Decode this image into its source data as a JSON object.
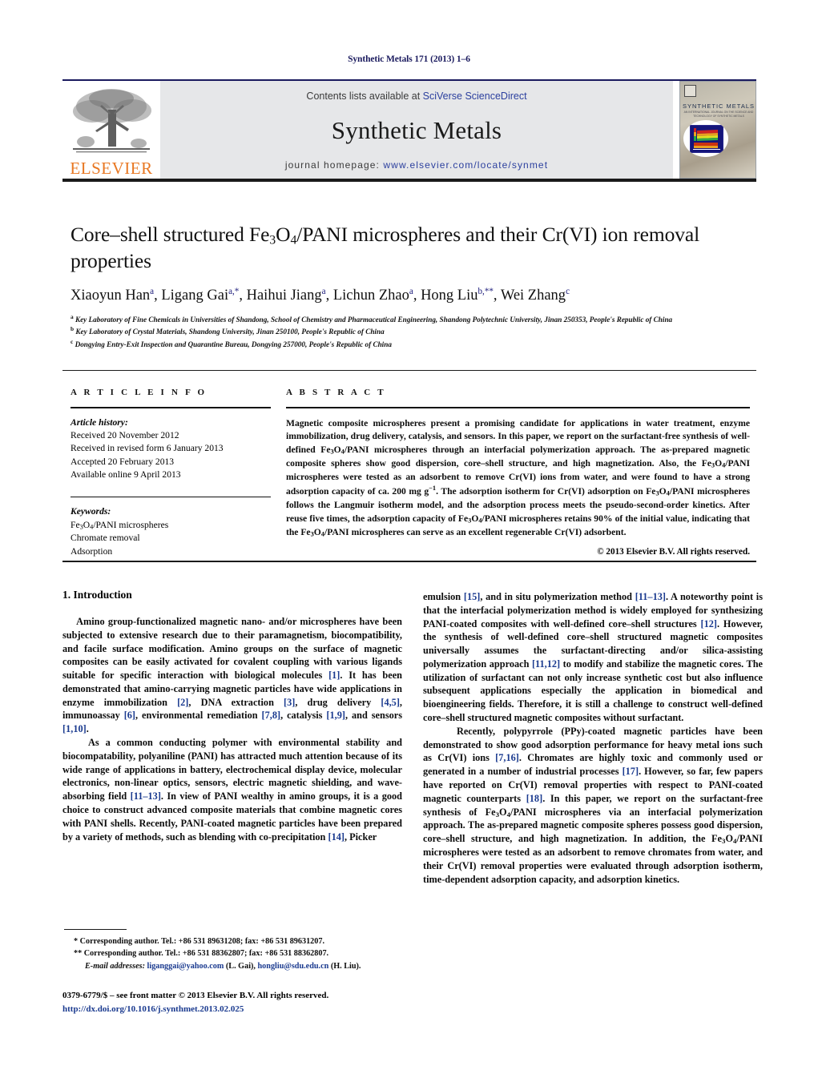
{
  "running_head": "Synthetic Metals 171 (2013) 1–6",
  "masthead": {
    "contents_prefix": "Contents lists available at ",
    "contents_brand": "SciVerse ScienceDirect",
    "journal_name": "Synthetic Metals",
    "homepage_prefix": "journal homepage: ",
    "homepage_url": "www.elsevier.com/locate/synmet",
    "publisher_wordmark": "ELSEVIER",
    "publisher_accent_color": "#E87722",
    "link_color": "#2b3f9e",
    "cover": {
      "title": "SYNTHETIC METALS",
      "subtitle": "AN INTERNATIONAL JOURNAL ON THE SCIENCE AND TECHNOLOGY OF SYNTHETIC METALS"
    }
  },
  "article": {
    "title_part1": "Core–shell structured Fe",
    "title_sub1": "3",
    "title_part2": "O",
    "title_sub2": "4",
    "title_part3": "/PANI microspheres and their Cr(VI) ion removal properties",
    "authors": "Xiaoyun Han a, Ligang Gai a,*, Haihui Jiang a, Lichun Zhao a, Hong Liu b,**, Wei Zhang c",
    "affiliations": [
      "a Key Laboratory of Fine Chemicals in Universities of Shandong, School of Chemistry and Pharmaceutical Engineering, Shandong Polytechnic University, Jinan 250353, People's Republic of China",
      "b Key Laboratory of Crystal Materials, Shandong University, Jinan 250100, People's Republic of China",
      "c Dongying Entry-Exit Inspection and Quarantine Bureau, Dongying 257000, People's Republic of China"
    ]
  },
  "article_info": {
    "heading": "A R T I C L E   I N F O",
    "history_label": "Article history:",
    "history": [
      "Received 20 November 2012",
      "Received in revised form 6 January 2013",
      "Accepted 20 February 2013",
      "Available online 9 April 2013"
    ],
    "keywords_label": "Keywords:",
    "keywords": [
      "Fe3O4/PANI microspheres",
      "Chromate removal",
      "Adsorption"
    ]
  },
  "abstract": {
    "heading": "A B S T R A C T",
    "text": "Magnetic composite microspheres present a promising candidate for applications in water treatment, enzyme immobilization, drug delivery, catalysis, and sensors. In this paper, we report on the surfactant-free synthesis of well-defined Fe3O4/PANI microspheres through an interfacial polymerization approach. The as-prepared magnetic composite spheres show good dispersion, core–shell structure, and high magnetization. Also, the Fe3O4/PANI microspheres were tested as an adsorbent to remove Cr(VI) ions from water, and were found to have a strong adsorption capacity of ca. 200 mg g−1. The adsorption isotherm for Cr(VI) adsorption on Fe3O4/PANI microspheres follows the Langmuir isotherm model, and the adsorption process meets the pseudo-second-order kinetics. After reuse five times, the adsorption capacity of Fe3O4/PANI microspheres retains 90% of the initial value, indicating that the Fe3O4/PANI microspheres can serve as an excellent regenerable Cr(VI) adsorbent.",
    "copyright": "© 2013 Elsevier B.V. All rights reserved."
  },
  "section": {
    "number_title": "1.  Introduction",
    "left_paragraphs": [
      "Amino group-functionalized magnetic nano- and/or microspheres have been subjected to extensive research due to their paramagnetism, biocompatibility, and facile surface modification. Amino groups on the surface of magnetic composites can be easily activated for covalent coupling with various ligands suitable for specific interaction with biological molecules [1]. It has been demonstrated that amino-carrying magnetic particles have wide applications in enzyme immobilization [2], DNA extraction [3], drug delivery [4,5], immunoassay [6], environmental remediation [7,8], catalysis [1,9], and sensors [1,10].",
      "As a common conducting polymer with environmental stability and biocompatability, polyaniline (PANI) has attracted much attention because of its wide range of applications in battery, electrochemical display device, molecular electronics, non-linear optics, sensors, electric magnetic shielding, and wave-absorbing field [11–13]. In view of PANI wealthy in amino groups, it is a good choice to construct advanced composite materials that combine magnetic cores with PANI shells. Recently, PANI-coated magnetic particles have been prepared by a variety of methods, such as blending with co-precipitation [14], Picker"
    ],
    "right_paragraphs": [
      "emulsion [15], and in situ polymerization method [11–13]. A noteworthy point is that the interfacial polymerization method is widely employed for synthesizing PANI-coated composites with well-defined core–shell structures [12]. However, the synthesis of well-defined core–shell structured magnetic composites universally assumes the surfactant-directing and/or silica-assisting polymerization approach [11,12] to modify and stabilize the magnetic cores. The utilization of surfactant can not only increase synthetic cost but also influence subsequent applications especially the application in biomedical and bioengineering fields. Therefore, it is still a challenge to construct well-defined core–shell structured magnetic composites without surfactant.",
      "Recently, polypyrrole (PPy)-coated magnetic particles have been demonstrated to show good adsorption performance for heavy metal ions such as Cr(VI) ions [7,16]. Chromates are highly toxic and commonly used or generated in a number of industrial processes [17]. However, so far, few papers have reported on Cr(VI) removal properties with respect to PANI-coated magnetic counterparts [18]. In this paper, we report on the surfactant-free synthesis of Fe3O4/PANI microspheres via an interfacial polymerization approach. The as-prepared magnetic composite spheres possess good dispersion, core–shell structure, and high magnetization. In addition, the Fe3O4/PANI microspheres were tested as an adsorbent to remove chromates from water, and their Cr(VI) removal properties were evaluated through adsorption isotherm, time-dependent adsorption capacity, and adsorption kinetics."
    ]
  },
  "footnotes": {
    "line1": "* Corresponding author. Tel.: +86 531 89631208; fax: +86 531 89631207.",
    "line2": "** Corresponding author. Tel.: +86 531 88362807; fax: +86 531 88362807.",
    "email_label": "E-mail addresses:",
    "email1": "liganggai@yahoo.com",
    "email1_owner": "(L. Gai),",
    "email2": "hongliu@sdu.edu.cn",
    "email2_owner": "(H. Liu)."
  },
  "publication_footer": {
    "issn_line": "0379-6779/$ – see front matter © 2013 Elsevier B.V. All rights reserved.",
    "doi": "http://dx.doi.org/10.1016/j.synthmet.2013.02.025"
  }
}
